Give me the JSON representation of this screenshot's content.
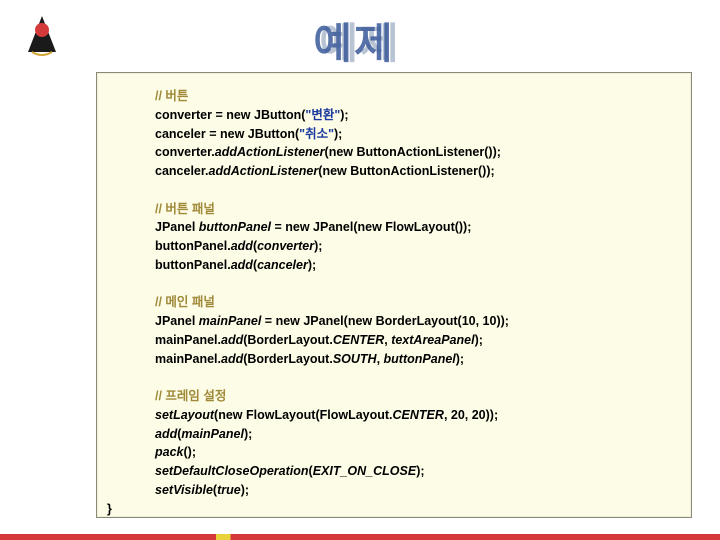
{
  "title": "예제",
  "logo_alt": "Java Duke logo",
  "code": {
    "block1": {
      "c": "// 버튼",
      "l1a": "converter = ",
      "l1b": "new",
      "l1c": " JButton(",
      "l1d": "\"변환\"",
      "l1e": ");",
      "l2a": "canceler = ",
      "l2b": "new",
      "l2c": " JButton(",
      "l2d": "\"취소\"",
      "l2e": ");",
      "l3a": "converter.",
      "l3b": "addActionListener",
      "l3c": "(",
      "l3d": "new",
      "l3e": " ButtonActionListener());",
      "l4a": "canceler.",
      "l4b": "addActionListener",
      "l4c": "(",
      "l4d": "new",
      "l4e": " ButtonActionListener());"
    },
    "block2": {
      "c": "// 버튼 패널",
      "l1a": "JPanel ",
      "l1b": "buttonPanel",
      "l1c": " = ",
      "l1d": "new",
      "l1e": " JPanel(",
      "l1f": "new",
      "l1g": " FlowLayout());",
      "l2a": "buttonPanel.",
      "l2b": "add",
      "l2c": "(",
      "l2d": "converter",
      "l2e": ");",
      "l3a": "buttonPanel.",
      "l3b": "add",
      "l3c": "(",
      "l3d": "canceler",
      "l3e": ");"
    },
    "block3": {
      "c": "// 메인 패널",
      "l1a": "JPanel ",
      "l1b": "mainPanel",
      "l1c": " = ",
      "l1d": "new",
      "l1e": " JPanel(",
      "l1f": "new",
      "l1g": " BorderLayout(10, 10));",
      "l2a": "mainPanel.",
      "l2b": "add",
      "l2c": "(BorderLayout.",
      "l2d": "CENTER",
      "l2e": ", ",
      "l2f": "textAreaPanel",
      "l2g": ");",
      "l3a": "mainPanel.",
      "l3b": "add",
      "l3c": "(BorderLayout.",
      "l3d": "SOUTH",
      "l3e": ", ",
      "l3f": "buttonPanel",
      "l3g": ");"
    },
    "block4": {
      "c": "// 프레임 설정",
      "l1a": "setLayout",
      "l1b": "(",
      "l1c": "new",
      "l1d": " FlowLayout(FlowLayout.",
      "l1e": "CENTER",
      "l1f": ", 20, 20));",
      "l2a": "add",
      "l2b": "(",
      "l2c": "mainPanel",
      "l2d": ");",
      "l3a": "pack",
      "l3b": "();",
      "l4a": "setDefaultCloseOperation",
      "l4b": "(",
      "l4c": "EXIT_ON_CLOSE",
      "l4d": ");",
      "l5a": "setVisible",
      "l5b": "(",
      "l5c": "true",
      "l5d": ");"
    },
    "close": "}"
  }
}
